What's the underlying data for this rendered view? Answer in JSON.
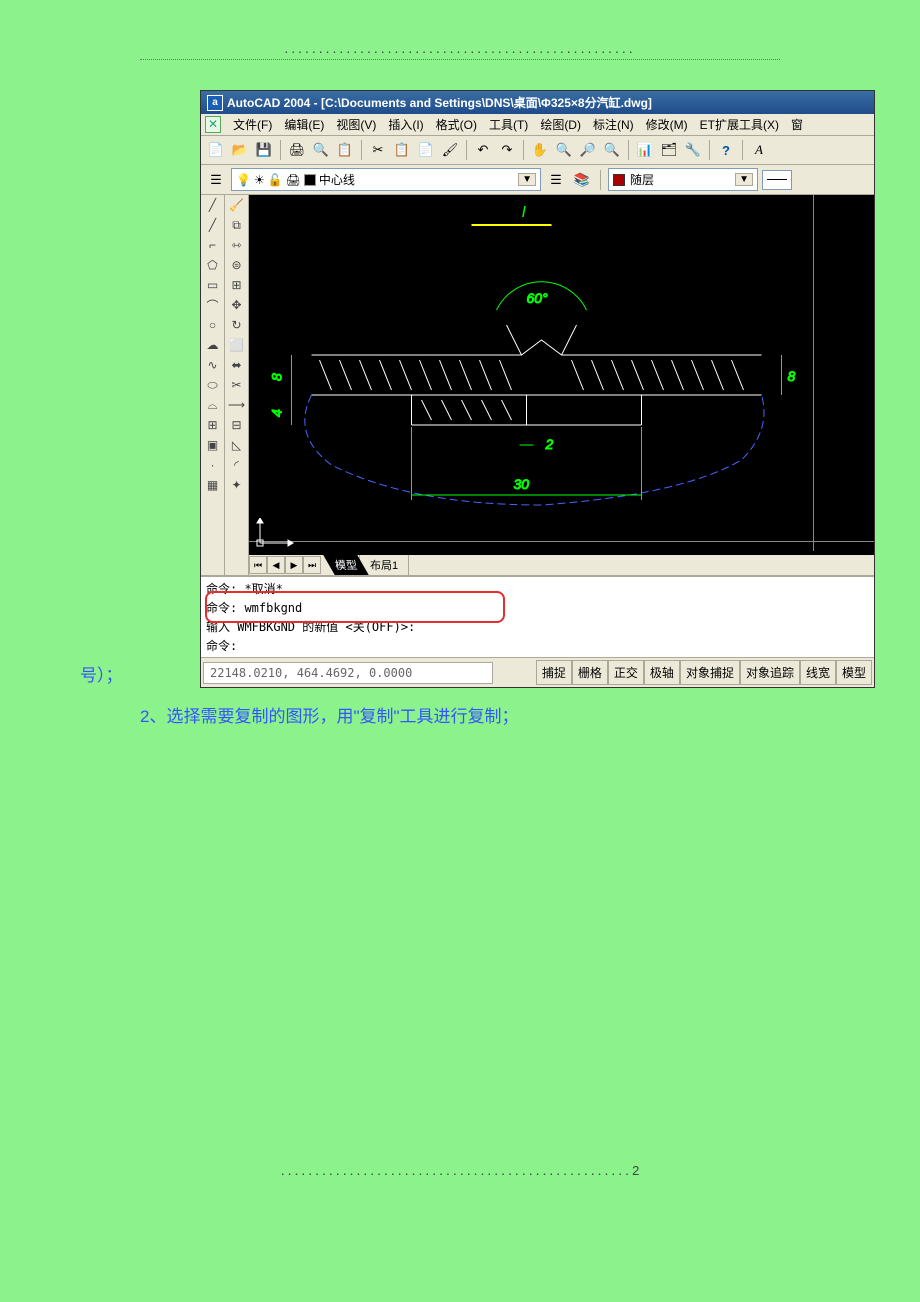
{
  "doc": {
    "header_dots": "...................................................",
    "line_before_img": "号）；",
    "body_line1": "2、选择需要复制的图形，用\"复制\"工具进行复制；",
    "footer_dots": "...................................................",
    "page_num": "2"
  },
  "app": {
    "title": "AutoCAD 2004 - [C:\\Documents and Settings\\DNS\\桌面\\Φ325×8分汽缸.dwg]",
    "menus": {
      "file": "文件(F)",
      "edit": "编辑(E)",
      "view": "视图(V)",
      "insert": "插入(I)",
      "format": "格式(O)",
      "tools": "工具(T)",
      "draw": "绘图(D)",
      "dim": "标注(N)",
      "modify": "修改(M)",
      "et": "ET扩展工具(X)",
      "window": "窗"
    },
    "layer_name": "中心线",
    "prop_name": "随层",
    "tabs": {
      "model": "模型",
      "layout1": "布局1"
    },
    "cmd": {
      "l1": "命令: *取消*",
      "l2": "命令: wmfbkgnd",
      "l3": "输入 WMFBKGND 的新值 <关(OFF)>:",
      "l4": "命令:"
    },
    "coords": "22148.0210, 464.4692, 0.0000",
    "status": {
      "b1": "捕捉",
      "b2": "栅格",
      "b3": "正交",
      "b4": "极轴",
      "b5": "对象捕捉",
      "b6": "对象追踪",
      "b7": "线宽",
      "b8": "模型"
    }
  },
  "drawing": {
    "angle": "60°",
    "dim8a": "8",
    "dim8b": "8",
    "dim4": "4",
    "dim2": "2",
    "dim30": "30",
    "ref": "I"
  }
}
